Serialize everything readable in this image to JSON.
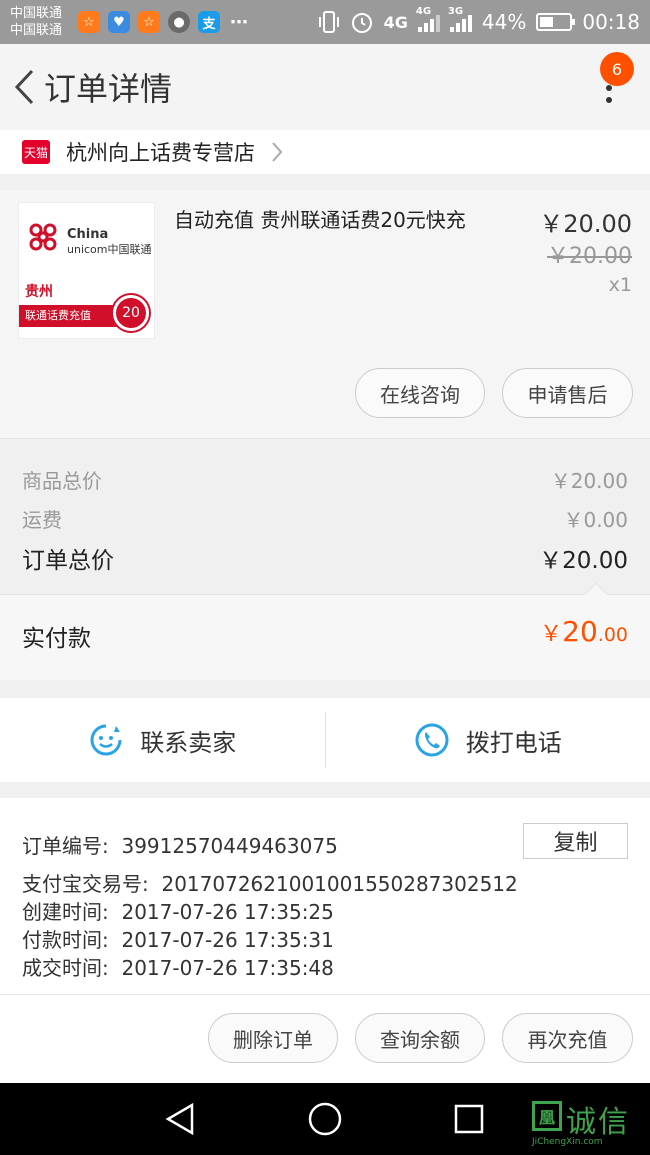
{
  "status_bar": {
    "carrier_1": "中国联通",
    "carrier_2": "中国联通",
    "network_1": "4G",
    "network_2": "4G",
    "network_3": "3G",
    "battery": "44%",
    "time": "00:18",
    "apps": [
      "uc-browser-icon",
      "health-icon",
      "uc-browser-icon",
      "avatar-icon",
      "alipay-icon",
      "more-icon"
    ]
  },
  "header": {
    "title": "订单详情",
    "badge": "6"
  },
  "shop": {
    "tag": "天猫",
    "name": "杭州向上话费专营店"
  },
  "product": {
    "title": "自动充值 贵州联通话费20元快充",
    "price": "￥20.00",
    "original_price": "￥20.00",
    "quantity": "x1",
    "thumb": {
      "brand_en_1": "China",
      "brand_en_2": "unicom中国联通",
      "province": "贵州",
      "band": "联通话费充值",
      "amount": "20"
    },
    "consult_label": "在线咨询",
    "after_sale_label": "申请售后"
  },
  "totals": {
    "goods_label": "商品总价",
    "goods_value": "￥20.00",
    "shipping_label": "运费",
    "shipping_value": "￥0.00",
    "order_total_label": "订单总价",
    "order_total_value": "￥20.00",
    "paid_label": "实付款",
    "paid_symbol": "￥",
    "paid_int": "20",
    "paid_dec": ".00"
  },
  "contact": {
    "seller_label": "联系卖家",
    "call_label": "拨打电话"
  },
  "info": {
    "order_no_label": "订单编号:",
    "order_no": "39912570449463075",
    "copy_label": "复制",
    "alipay_label": "支付宝交易号:",
    "alipay_no": "2017072621001001550287302512",
    "created_label": "创建时间:",
    "created": "2017-07-26 17:35:25",
    "paid_label": "付款时间:",
    "paid": "2017-07-26 17:35:31",
    "done_label": "成交时间:",
    "done": "2017-07-26 17:35:48"
  },
  "actions": {
    "delete_label": "删除订单",
    "balance_label": "查询余额",
    "recharge_label": "再次充值"
  },
  "watermark": {
    "mark": "凰",
    "text": "诚信",
    "sub": "JiChengXin.com"
  },
  "colors": {
    "accent": "#ff5000",
    "icon_blue": "#27a3e6",
    "tmall_red": "#e4002b",
    "unicom_red": "#d0102a"
  }
}
